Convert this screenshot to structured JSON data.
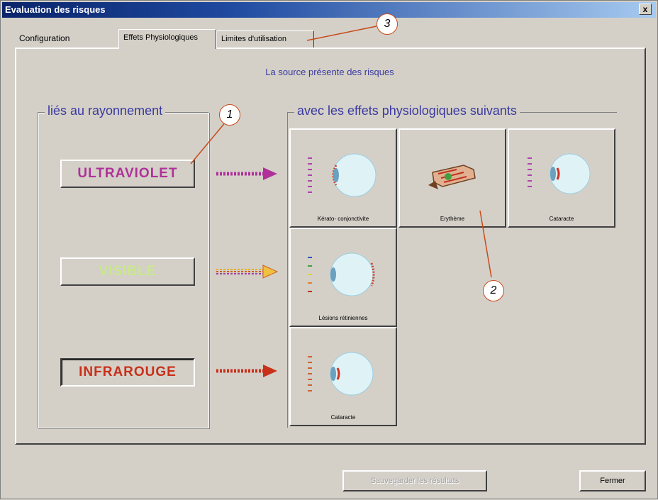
{
  "window": {
    "title": "Evaluation des risques",
    "close_label": "x"
  },
  "tabs": [
    {
      "label": "Configuration"
    },
    {
      "label": "Effets Physiologiques"
    },
    {
      "label": "Limites d'utilisation"
    }
  ],
  "main": {
    "source_text": "La source présente des risques",
    "left_group_title": "liés au rayonnement",
    "right_group_title": "avec les effets physiologiques suivants",
    "radiations": [
      {
        "label": "ULTRAVIOLET",
        "color": "#b0309a",
        "enabled": true
      },
      {
        "label": "VISIBLE",
        "color": "#c8e88a",
        "enabled": false
      },
      {
        "label": "INFRAROUGE",
        "color": "#c8301a",
        "enabled": true
      }
    ],
    "effects": {
      "uv": [
        "Kérato- conjonctivite",
        "Erythème",
        "Cataracte"
      ],
      "visible": [
        "Lésions rétiniennes"
      ],
      "ir": [
        "Cataracte"
      ]
    }
  },
  "footer": {
    "save_label": "Sauvegarder les résultats",
    "close_label": "Fermer"
  },
  "callouts": [
    "1",
    "2",
    "3"
  ],
  "colors": {
    "callout_line": "#c84a1a",
    "text_blue": "#3a3aa0",
    "titlebar": "#0a246a"
  }
}
